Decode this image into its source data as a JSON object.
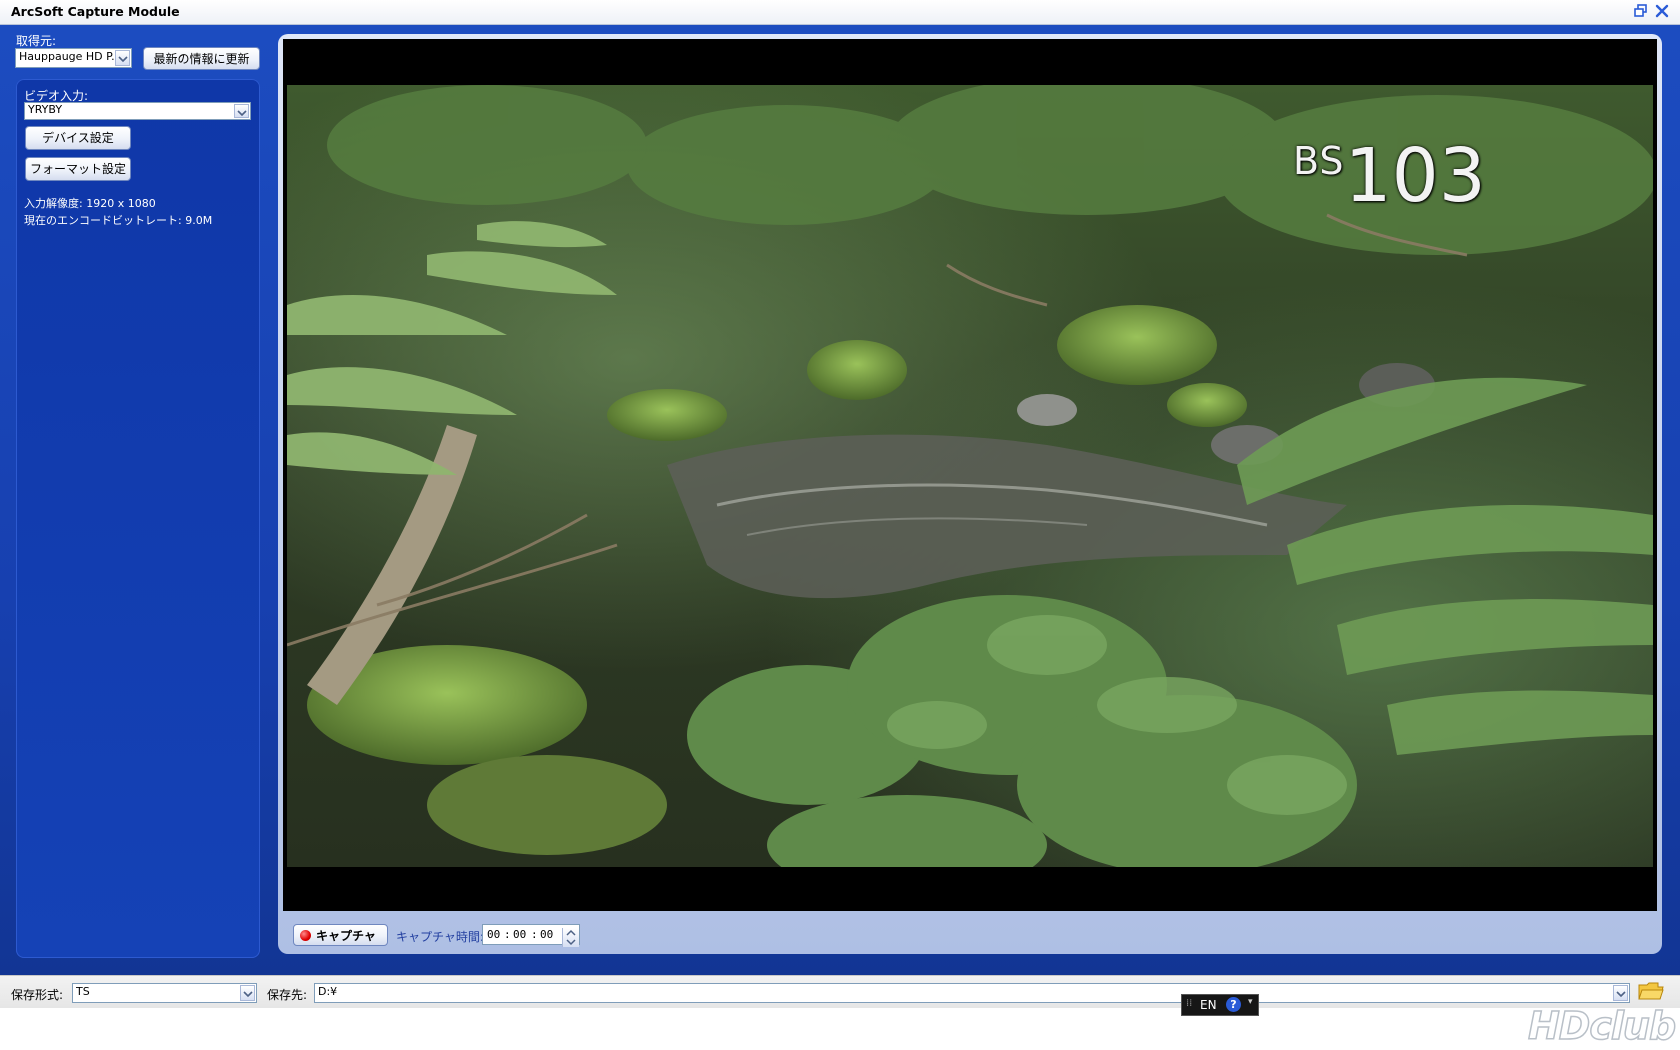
{
  "window": {
    "title": "ArcSoft Capture Module"
  },
  "source": {
    "label": "取得元:",
    "value": "Hauppauge HD P...",
    "refresh_label": "最新の情報に更新"
  },
  "video_input": {
    "label": "ビデオ入力:",
    "value": "YRYBY",
    "device_settings_label": "デバイス設定",
    "format_settings_label": "フォーマット設定"
  },
  "info": {
    "resolution": "入力解像度: 1920 x 1080",
    "bitrate": "現在のエンコードビットレート: 9.0M"
  },
  "preview": {
    "channel_prefix": "BS",
    "channel_number": "103"
  },
  "capture": {
    "button_label": "キャプチャ",
    "time_label": "キャプチャ時間:",
    "time_h": "00",
    "time_m": "00",
    "time_s": "00"
  },
  "save": {
    "format_label": "保存形式:",
    "format_value": "TS",
    "dest_label": "保存先:",
    "dest_value": "D:¥"
  },
  "language_bar": {
    "lang": "EN"
  },
  "icons": {
    "restore": "restore-icon",
    "close": "close-icon",
    "folder": "folder-icon",
    "help": "help-icon"
  }
}
